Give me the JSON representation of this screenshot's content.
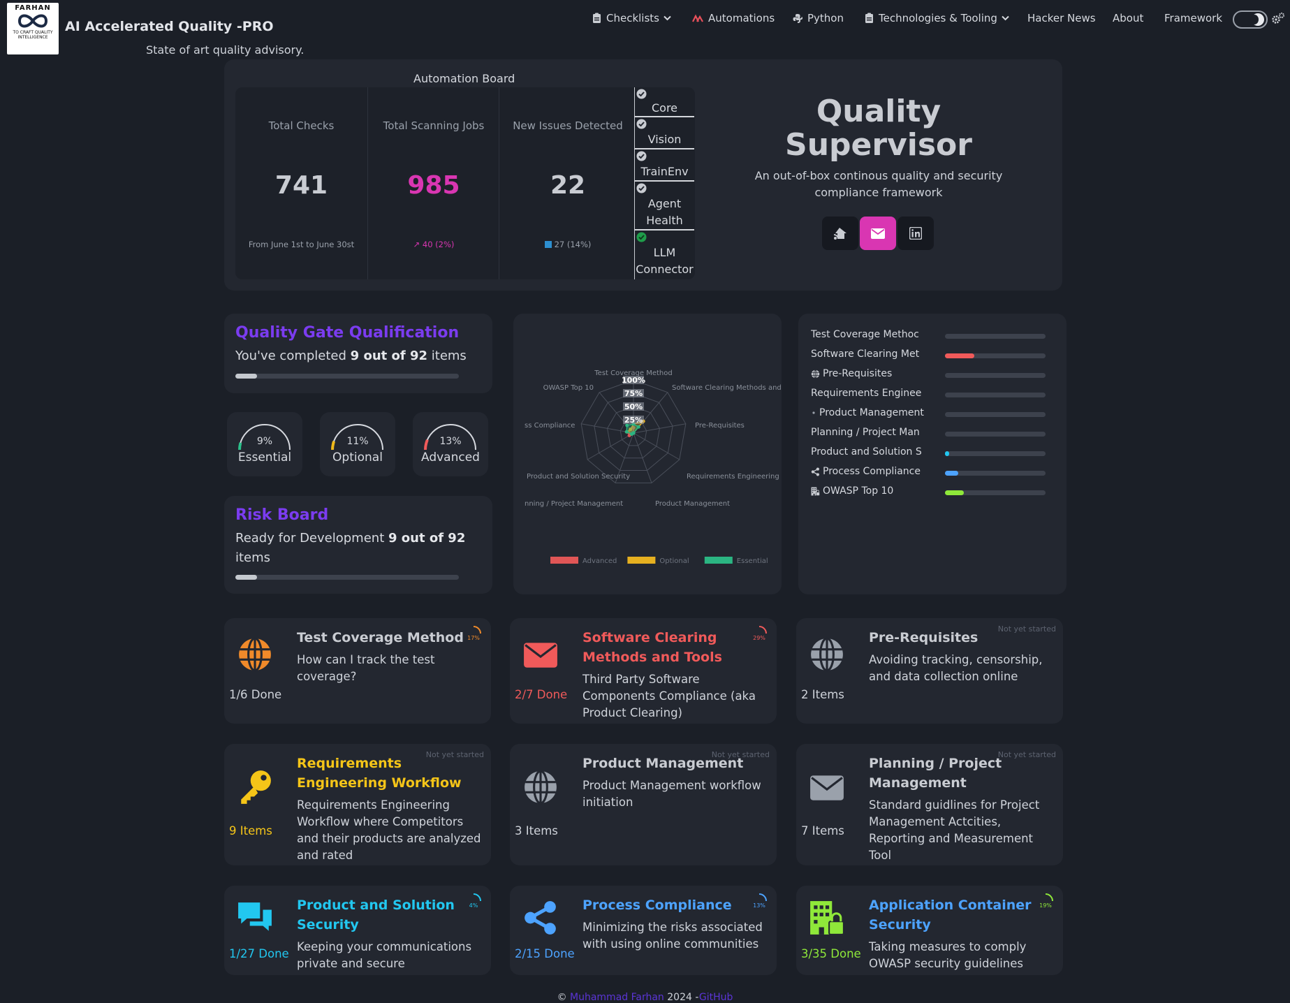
{
  "header": {
    "logo": {
      "top": "FARHAN",
      "bottom": "TO CRAFT QUALITY INTELLIGENCE"
    },
    "title": "AI Accelerated Quality -PRO",
    "subtitle": "State of art quality advisory.",
    "nav": [
      "Checklists",
      "Automations",
      "Python",
      "Technologies & Tooling",
      "Hacker News",
      "About",
      "Framework"
    ]
  },
  "board": {
    "title": "Automation Board",
    "stats": [
      {
        "label": "Total Checks",
        "value": "741",
        "note": "From June 1st to June 30st",
        "color": "#c9ccd2"
      },
      {
        "label": "Total Scanning Jobs",
        "value": "985",
        "note": "↗ 40 (2%)",
        "color": "#d936b2"
      },
      {
        "label": "New Issues Detected",
        "value": "22",
        "note": "27 (14%)",
        "color": "#c9ccd2"
      }
    ],
    "statuses": [
      "Core",
      "Vision",
      "TrainEnv",
      "Agent Health",
      "LLM Connector"
    ]
  },
  "hero": {
    "title": "Quality Supervisor",
    "subtitle": "An out-of-box continous quality and security compliance framework"
  },
  "quality_gate": {
    "title": "Quality Gate Qualification",
    "text_pre": "You've completed",
    "text_bold": "9 out of 92",
    "text_post": "items",
    "progress": 0.098
  },
  "gauges": [
    {
      "pct": "9%",
      "label": "Essential",
      "value": 0.09,
      "color": "#2bbf8a"
    },
    {
      "pct": "11%",
      "label": "Optional",
      "value": 0.11,
      "color": "#f0b91a"
    },
    {
      "pct": "13%",
      "label": "Advanced",
      "value": 0.13,
      "color": "#f05a5a"
    }
  ],
  "risk_board": {
    "title": "Risk Board",
    "text_pre": "Ready for Development",
    "text_bold": "9 out of 92",
    "text_post": "items",
    "progress": 0.098
  },
  "chart_data": {
    "type": "radar",
    "categories": [
      "Test Coverage Method",
      "Software Clearing Methods and Tools",
      "Pre-Requisites",
      "Requirements Engineering",
      "Product Management",
      "Planning / Project Management",
      "Product and Solution Security",
      "Process Compliance",
      "OWASP Top 10"
    ],
    "tick_labels": [
      "25%",
      "50%",
      "75%",
      "100%"
    ],
    "range": [
      0,
      100
    ],
    "series": [
      {
        "name": "Advanced",
        "color": "#e05656",
        "values": [
          10,
          0,
          0,
          0,
          0,
          0,
          9,
          10,
          9
        ]
      },
      {
        "name": "Optional",
        "color": "#e6b020",
        "values": [
          17,
          29,
          0,
          0,
          0,
          0,
          4,
          13,
          9
        ]
      },
      {
        "name": "Essential",
        "color": "#2bb582",
        "values": [
          17,
          15,
          0,
          0,
          0,
          0,
          4,
          13,
          19
        ]
      }
    ]
  },
  "progress_bars": [
    {
      "label": "Test Coverage Methoc",
      "value": 0,
      "color": "#e06060",
      "icon": ""
    },
    {
      "label": "Software Clearing Met",
      "value": 0.29,
      "color": "#f05a5a",
      "icon": ""
    },
    {
      "label": "Pre-Requisites",
      "value": 0,
      "color": "#4da3ff",
      "icon": "globe-icon"
    },
    {
      "label": "Requirements Enginee",
      "value": 0,
      "color": "#f0b91a",
      "icon": ""
    },
    {
      "label": "Product Management",
      "value": 0,
      "color": "#4da3ff",
      "icon": "dot-icon"
    },
    {
      "label": "Planning / Project Man",
      "value": 0,
      "color": "#4da3ff",
      "icon": ""
    },
    {
      "label": "Product and Solution S",
      "value": 0.04,
      "color": "#22c7f0",
      "icon": ""
    },
    {
      "label": "Process Compliance",
      "value": 0.13,
      "color": "#4da3ff",
      "icon": "share-icon"
    },
    {
      "label": "OWASP Top 10",
      "value": 0.19,
      "color": "#8fe83a",
      "icon": "building-icon"
    }
  ],
  "tiles": [
    {
      "title": "Test Coverage Method",
      "desc": "How can I track the test coverage?",
      "count": "1/6 Done",
      "icon": "globe-icon",
      "color": "#f08a2a",
      "title_color": "#c9ccd2",
      "status": "",
      "progress": "17%"
    },
    {
      "title": "Software Clearing Methods and Tools",
      "desc": "Third Party Software Components Compliance (aka Product Clearing)",
      "count": "2/7 Done",
      "icon": "envelope-icon",
      "color": "#f05a5a",
      "title_color": "#f05a5a",
      "status": "",
      "progress": "29%"
    },
    {
      "title": "Pre-Requisites",
      "desc": "Avoiding tracking, censorship, and data collection online",
      "count": "2 Items",
      "icon": "globe-icon",
      "color": "#9aa1ab",
      "title_color": "#c9ccd2",
      "status": "Not yet started",
      "progress": ""
    },
    {
      "title": "Requirements Engineering Workflow",
      "desc": "Requirements Engineering Workflow where Competitors and their products are analyzed and rated",
      "count": "9 Items",
      "icon": "key-icon",
      "color": "#f5c518",
      "title_color": "#f5c518",
      "status": "Not yet started",
      "progress": ""
    },
    {
      "title": "Product Management",
      "desc": "Product Management workflow initiation",
      "count": "3 Items",
      "icon": "globe-icon",
      "color": "#9aa1ab",
      "title_color": "#c9ccd2",
      "status": "Not yet started",
      "progress": ""
    },
    {
      "title": "Planning / Project Management",
      "desc": "Standard guidlines for Project Management Actcities, Reporting and Measurement Tool",
      "count": "7 Items",
      "icon": "envelope-icon",
      "color": "#9aa1ab",
      "title_color": "#c9ccd2",
      "status": "Not yet started",
      "progress": ""
    },
    {
      "title": "Product and Solution Security",
      "desc": "Keeping your communications private and secure",
      "count": "1/27 Done",
      "icon": "chat-icon",
      "color": "#22c7f0",
      "title_color": "#22c7f0",
      "status": "",
      "progress": "4%"
    },
    {
      "title": "Process Compliance",
      "desc": "Minimizing the risks associated with using online communities",
      "count": "2/15 Done",
      "icon": "share-icon",
      "color": "#4da3ff",
      "title_color": "#4da3ff",
      "status": "",
      "progress": "13%"
    },
    {
      "title": "Application Container Security",
      "desc": "Taking measures to comply OWASP security guidelines",
      "count": "3/35 Done",
      "icon": "building-icon",
      "color": "#8fe83a",
      "title_color": "#4da3ff",
      "status": "",
      "progress": "19%"
    }
  ],
  "footer": {
    "copy": "©",
    "author": "Muhammad Farhan",
    "year": "2024 -",
    "link": "GitHub"
  }
}
